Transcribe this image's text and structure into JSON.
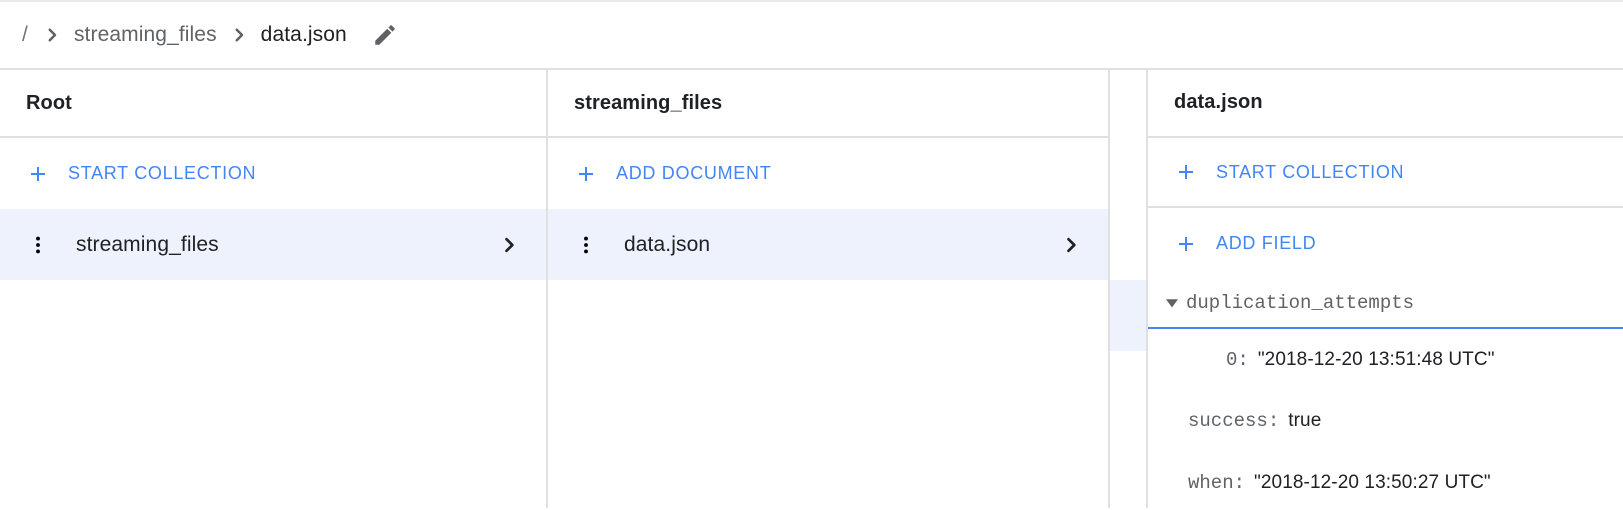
{
  "breadcrumb": {
    "root": "/",
    "items": [
      "streaming_files",
      "data.json"
    ],
    "edit_icon": "pencil-icon",
    "separator_icon": "chevron-right-icon"
  },
  "panels": [
    {
      "title": "Root",
      "actions": [
        {
          "icon": "plus-icon",
          "label": "START COLLECTION"
        }
      ],
      "rows": [
        {
          "label": "streaming_files",
          "selected": true,
          "menu_icon": "kebab-menu-icon",
          "chevron_icon": "chevron-right-icon"
        }
      ]
    },
    {
      "title": "streaming_files",
      "actions": [
        {
          "icon": "plus-icon",
          "label": "ADD DOCUMENT"
        }
      ],
      "rows": [
        {
          "label": "data.json",
          "selected": true,
          "menu_icon": "kebab-menu-icon",
          "chevron_icon": "chevron-right-icon"
        }
      ]
    },
    {
      "title": "data.json",
      "actions": [
        {
          "icon": "plus-icon",
          "label": "START COLLECTION"
        },
        {
          "icon": "plus-icon",
          "label": "ADD FIELD"
        }
      ],
      "fields": [
        {
          "key": "duplication_attempts",
          "value": "",
          "type": "array",
          "expanded": true,
          "caret_icon": "caret-down-icon",
          "indent": 0
        },
        {
          "key": "0",
          "value": "\"2018-12-20 13:51:48 UTC\"",
          "type": "string",
          "indent": 2
        },
        {
          "key": "success",
          "value": "true",
          "type": "boolean",
          "indent": 1
        },
        {
          "key": "when",
          "value": "\"2018-12-20 13:50:27 UTC\"",
          "type": "string",
          "indent": 1
        }
      ]
    }
  ],
  "colors": {
    "accent": "#4285f4",
    "selected_row_bg": "#eef2fc",
    "divider": "#e0e0e0",
    "text_primary": "#202124",
    "text_secondary": "#5f6368"
  }
}
